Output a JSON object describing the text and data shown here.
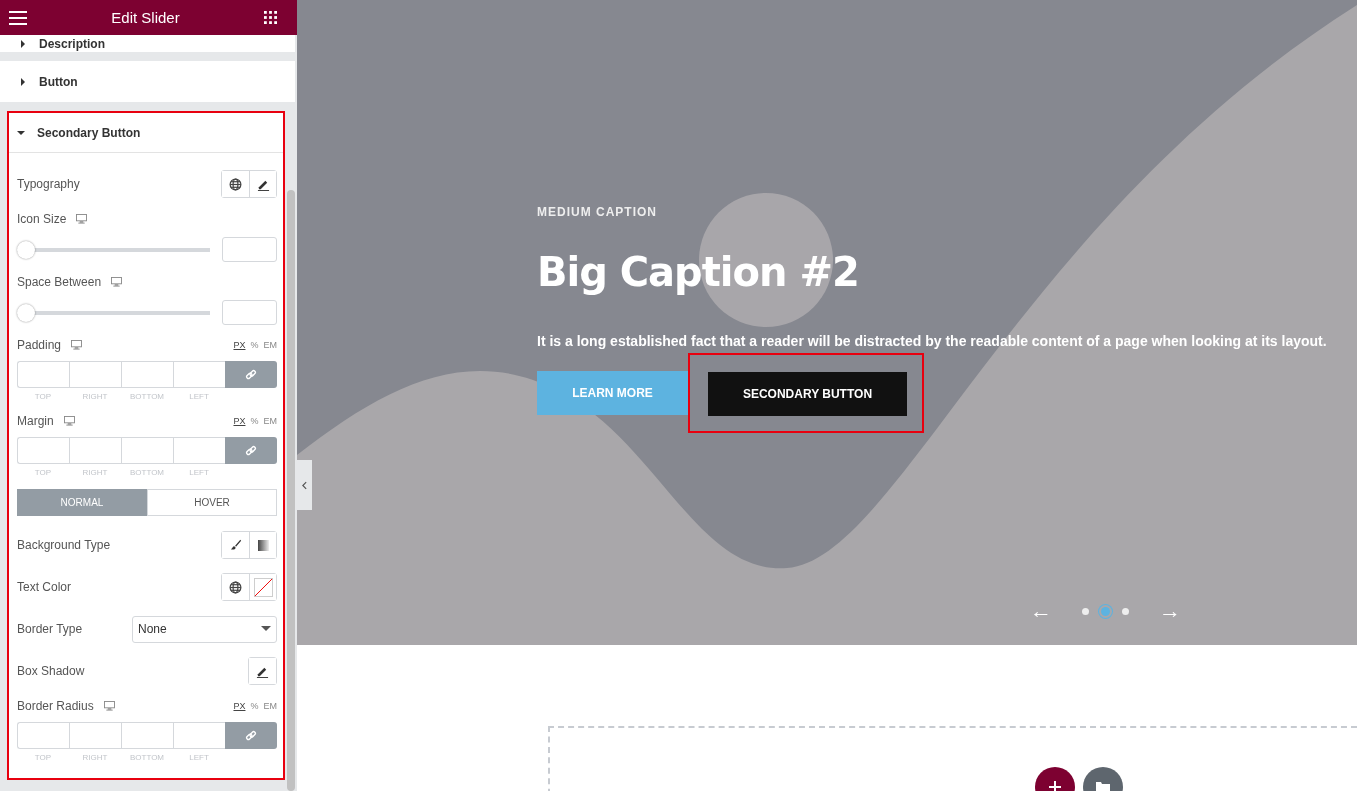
{
  "header": {
    "title": "Edit Slider"
  },
  "sections": [
    {
      "title": "Description",
      "expanded": false
    },
    {
      "title": "Button",
      "expanded": false
    },
    {
      "title": "Secondary Button",
      "expanded": true,
      "highlighted": true,
      "controls": [
        {
          "kind": "typography",
          "label": "Typography"
        },
        {
          "kind": "slider",
          "label": "Icon Size",
          "responsive": true,
          "level": 0
        },
        {
          "kind": "slider",
          "label": "Space Between",
          "responsive": true,
          "level": 0
        },
        {
          "kind": "dimensions",
          "label": "Padding",
          "responsive": true,
          "units": [
            {
              "label": "PX",
              "selected": true
            },
            {
              "label": "%",
              "selected": false
            },
            {
              "label": "EM",
              "selected": false
            }
          ],
          "sides": [
            "TOP",
            "RIGHT",
            "BOTTOM",
            "LEFT"
          ]
        },
        {
          "kind": "dimensions",
          "label": "Margin",
          "responsive": true,
          "units": [
            {
              "label": "PX",
              "selected": true
            },
            {
              "label": "%",
              "selected": false
            },
            {
              "label": "EM",
              "selected": false
            }
          ],
          "sides": [
            "TOP",
            "RIGHT",
            "BOTTOM",
            "LEFT"
          ]
        },
        {
          "kind": "tabs",
          "tabs": [
            {
              "label": "NORMAL",
              "selected": true
            },
            {
              "label": "HOVER",
              "selected": false
            }
          ]
        },
        {
          "kind": "background",
          "label": "Background Type"
        },
        {
          "kind": "color",
          "label": "Text Color"
        },
        {
          "kind": "select",
          "label": "Border Type",
          "value": "None"
        },
        {
          "kind": "shadow",
          "label": "Box Shadow"
        },
        {
          "kind": "dimensions",
          "label": "Border Radius",
          "responsive": true,
          "units": [
            {
              "label": "PX",
              "selected": true
            },
            {
              "label": "%",
              "selected": false
            },
            {
              "label": "EM",
              "selected": false
            }
          ],
          "sides": [
            "TOP",
            "RIGHT",
            "BOTTOM",
            "LEFT"
          ]
        }
      ]
    }
  ],
  "slide": {
    "subtitle": "MEDIUM CAPTION",
    "title": "Big Caption #2",
    "text": "It is a long established fact that a reader will be distracted by the readable content of a page when looking at its layout.",
    "buttons": [
      {
        "label": "LEARN MORE",
        "kind": "primary"
      },
      {
        "label": "SECONDARY BUTTON",
        "kind": "secondary",
        "highlighted": true
      }
    ],
    "prev": "←",
    "next": "→",
    "dots": [
      {
        "selected": false
      },
      {
        "selected": true
      },
      {
        "selected": false
      }
    ]
  }
}
